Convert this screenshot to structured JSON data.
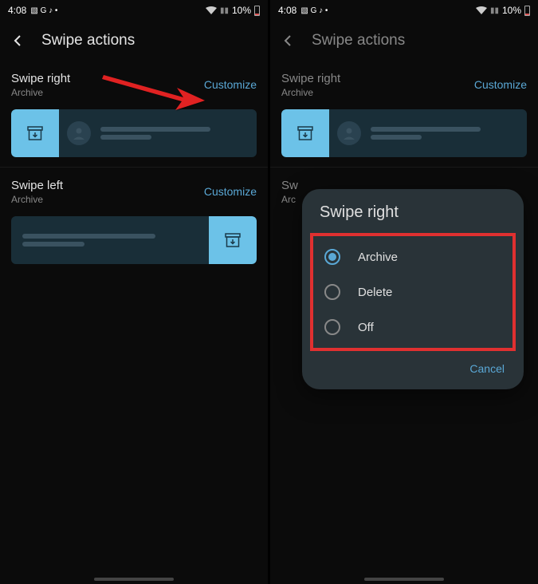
{
  "status": {
    "time": "4:08",
    "battery_pct": "10%"
  },
  "page_title": "Swipe actions",
  "sections": {
    "right": {
      "title": "Swipe right",
      "sub": "Archive",
      "customize": "Customize"
    },
    "left": {
      "title": "Swipe left",
      "sub": "Archive",
      "customize": "Customize"
    }
  },
  "dialog": {
    "title": "Swipe right",
    "options": {
      "archive": "Archive",
      "delete": "Delete",
      "off": "Off"
    },
    "cancel": "Cancel"
  }
}
